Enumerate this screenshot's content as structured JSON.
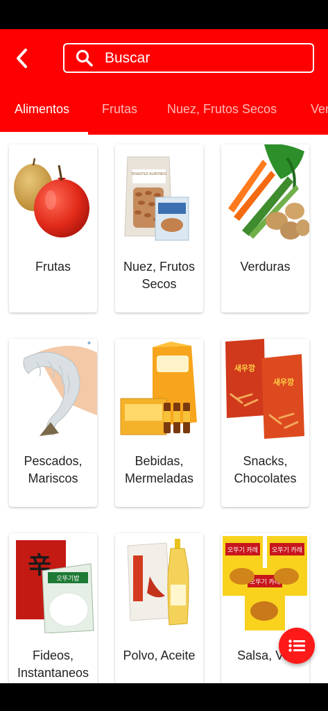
{
  "header": {
    "search_placeholder": "Buscar"
  },
  "tabs": [
    {
      "label": "Alimentos",
      "active": true
    },
    {
      "label": "Frutas",
      "active": false
    },
    {
      "label": "Nuez, Frutos Secos",
      "active": false
    },
    {
      "label": "Ver",
      "active": false
    }
  ],
  "categories": [
    {
      "label": "Frutas"
    },
    {
      "label": "Nuez, Frutos Secos"
    },
    {
      "label": "Verduras"
    },
    {
      "label": "Pescados, Mariscos"
    },
    {
      "label": "Bebidas, Mermeladas"
    },
    {
      "label": "Snacks, Chocolates"
    },
    {
      "label": "Fideos, Instantaneos"
    },
    {
      "label": "Polvo, Aceite"
    },
    {
      "label": "Salsa, Vin"
    }
  ],
  "product_text": {
    "almonds_brand": "ROASTED ALMONDS",
    "curry_text": "오뚜기 카레",
    "rice_text": "오뚜기밥",
    "ramen_text": "辛",
    "snack_text": "새우깡"
  },
  "colors": {
    "brand": "#ff0000",
    "fab": "#ff1a1a"
  },
  "icons": {
    "back": "chevron-left-icon",
    "search": "search-icon",
    "fab": "list-icon"
  }
}
